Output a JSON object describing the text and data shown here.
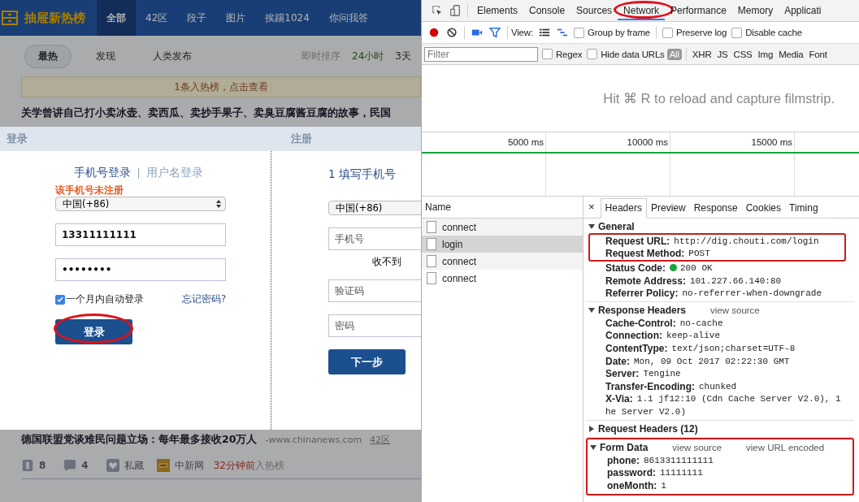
{
  "site": {
    "logo": "抽屉新热榜",
    "nav": [
      {
        "label": "全部",
        "selected": true
      },
      {
        "label": "42区",
        "selected": false
      },
      {
        "label": "段子",
        "selected": false
      },
      {
        "label": "图片",
        "selected": false
      },
      {
        "label": "挨踢1024",
        "selected": false
      },
      {
        "label": "你问我答",
        "selected": false
      }
    ],
    "filters": [
      {
        "label": "最热",
        "selected": true
      },
      {
        "label": "发现",
        "selected": false
      },
      {
        "label": "人类发布",
        "selected": false
      }
    ],
    "sort_label": "即时排序",
    "sort_options": [
      {
        "label": "24小时",
        "selected": true
      },
      {
        "label": "3天",
        "selected": false
      }
    ],
    "notice": "1条入热榜，点击查看",
    "headline": "关学曾讲自己打小卖冰壶、卖西瓜、卖抄手果子、卖臭豆腐酱豆腐的故事，民国"
  },
  "login_modal": {
    "login_title": "登录",
    "register_title": "注册",
    "login_tabs": [
      {
        "label": "手机号登录",
        "selected": true
      },
      {
        "label": "用户名登录",
        "selected": false
      }
    ],
    "error": "该手机号未注册",
    "country": "中国(+86)",
    "phone": "13311111111",
    "password": "••••••••",
    "remember": {
      "label": "一个月内自动登录",
      "checked": true
    },
    "forgot": "忘记密码?",
    "login_button": {
      "label": "登录",
      "highlighted": true
    },
    "register": {
      "step": "1 填写手机号",
      "country": "中国(+86)",
      "phone_placeholder": "手机号",
      "sms_hint": "收不到",
      "code_placeholder": "验证码",
      "password_placeholder": "密码",
      "next_button": "下一步"
    }
  },
  "article": {
    "title": "德国联盟党谈难民问题立场：每年最多接收20万人",
    "source": "-www.chinanews.com",
    "zone": "42区",
    "votes": "8",
    "comments": "4",
    "save": "私藏",
    "publisher": "中新网",
    "time": "32分钟前",
    "time_suffix": "入热榜"
  },
  "devtools": {
    "tabs": [
      {
        "label": "Elements",
        "selected": false,
        "highlighted": false
      },
      {
        "label": "Console",
        "selected": false,
        "highlighted": false
      },
      {
        "label": "Sources",
        "selected": false,
        "highlighted": false
      },
      {
        "label": "Network",
        "selected": true,
        "highlighted": true
      },
      {
        "label": "Performance",
        "selected": false,
        "highlighted": false
      },
      {
        "label": "Memory",
        "selected": false,
        "highlighted": false
      },
      {
        "label": "Applicati",
        "selected": false,
        "highlighted": false
      }
    ],
    "view_label": "View:",
    "toolbar_checks": [
      {
        "label": "Group by frame",
        "checked": false
      },
      {
        "label": "Preserve log",
        "checked": false
      },
      {
        "label": "Disable cache",
        "checked": false
      }
    ],
    "filter_placeholder": "Filter",
    "filter_checks": [
      {
        "label": "Regex",
        "checked": false
      },
      {
        "label": "Hide data URLs",
        "checked": false
      }
    ],
    "types": [
      {
        "label": "All",
        "selected": true
      },
      {
        "label": "XHR",
        "selected": false
      },
      {
        "label": "JS",
        "selected": false
      },
      {
        "label": "CSS",
        "selected": false
      },
      {
        "label": "Img",
        "selected": false
      },
      {
        "label": "Media",
        "selected": false
      },
      {
        "label": "Font",
        "selected": false
      }
    ],
    "filmstrip_hint": "Hit ⌘ R to reload and capture filmstrip.",
    "timeline_ticks": [
      "5000 ms",
      "10000 ms",
      "15000 ms"
    ],
    "name_header": "Name",
    "requests": [
      {
        "name": "connect",
        "selected": false
      },
      {
        "name": "login",
        "selected": true
      },
      {
        "name": "connect",
        "selected": false
      },
      {
        "name": "connect",
        "selected": false
      }
    ],
    "close": "×",
    "detail_tabs": [
      {
        "label": "Headers",
        "selected": true
      },
      {
        "label": "Preview",
        "selected": false
      },
      {
        "label": "Response",
        "selected": false
      },
      {
        "label": "Cookies",
        "selected": false
      },
      {
        "label": "Timing",
        "selected": false
      }
    ],
    "sections": [
      {
        "title": "General",
        "expanded": true,
        "highlighted": false,
        "blocks": [
          {
            "highlighted": true,
            "rows": [
              {
                "key": "Request URL:",
                "value": "http://dig.chouti.com/login",
                "kind": "text"
              },
              {
                "key": "Request Method:",
                "value": "POST",
                "kind": "text"
              }
            ]
          },
          {
            "highlighted": false,
            "rows": [
              {
                "key": "Status Code:",
                "value": "200 OK",
                "kind": "status"
              },
              {
                "key": "Remote Address:",
                "value": "101.227.66.140:80",
                "kind": "text"
              },
              {
                "key": "Referrer Policy:",
                "value": "no-referrer-when-downgrade",
                "kind": "text"
              }
            ]
          }
        ]
      },
      {
        "title": "Response Headers",
        "expanded": true,
        "highlighted": false,
        "links": [
          "view source"
        ],
        "blocks": [
          {
            "highlighted": false,
            "rows": [
              {
                "key": "Cache-Control:",
                "value": "no-cache",
                "kind": "text"
              },
              {
                "key": "Connection:",
                "value": "keep-alive",
                "kind": "text"
              },
              {
                "key": "ContentType:",
                "value": "text/json;charset=UTF-8",
                "kind": "text"
              },
              {
                "key": "Date:",
                "value": "Mon, 09 Oct 2017 02:22:30 GMT",
                "kind": "text"
              },
              {
                "key": "Server:",
                "value": "Tengine",
                "kind": "text"
              },
              {
                "key": "Transfer-Encoding:",
                "value": "chunked",
                "kind": "text"
              },
              {
                "key": "X-Via:",
                "value": "1.1 jf12:10 (Cdn Cache Server V2.0), 1",
                "continuation": "he Server V2.0)",
                "kind": "text"
              }
            ]
          }
        ]
      },
      {
        "title": "Request Headers (12)",
        "expanded": false,
        "highlighted": false
      },
      {
        "title": "Form Data",
        "expanded": true,
        "highlighted": true,
        "links": [
          "view source",
          "view URL encoded"
        ],
        "blocks": [
          {
            "highlighted": false,
            "rows": [
              {
                "key": "phone:",
                "value": "8613311111111",
                "kind": "text"
              },
              {
                "key": "password:",
                "value": "11111111",
                "kind": "text"
              },
              {
                "key": "oneMonth:",
                "value": "1",
                "kind": "text"
              }
            ]
          }
        ]
      }
    ]
  }
}
